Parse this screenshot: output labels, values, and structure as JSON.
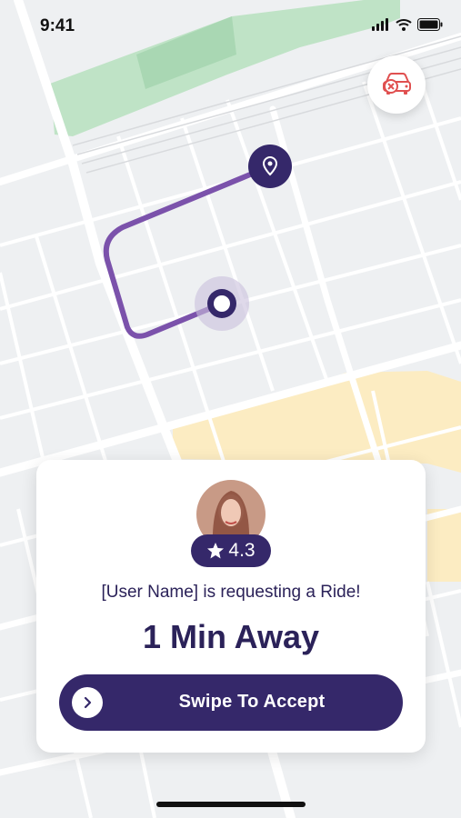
{
  "status_bar": {
    "time": "9:41"
  },
  "map": {
    "icons": [
      "cancel-ride-icon",
      "destination-pin-icon",
      "current-location-icon"
    ]
  },
  "request_card": {
    "rating": "4.3",
    "request_text": "[User Name] is requesting a Ride!",
    "eta_text": "1 Min Away",
    "swipe_label": "Swipe To Accept"
  },
  "colors": {
    "primary": "#35286a",
    "route": "#7b52ab",
    "park": "#a8d8b0",
    "commercial": "#fde7b3",
    "cancel_icon": "#e05050"
  }
}
